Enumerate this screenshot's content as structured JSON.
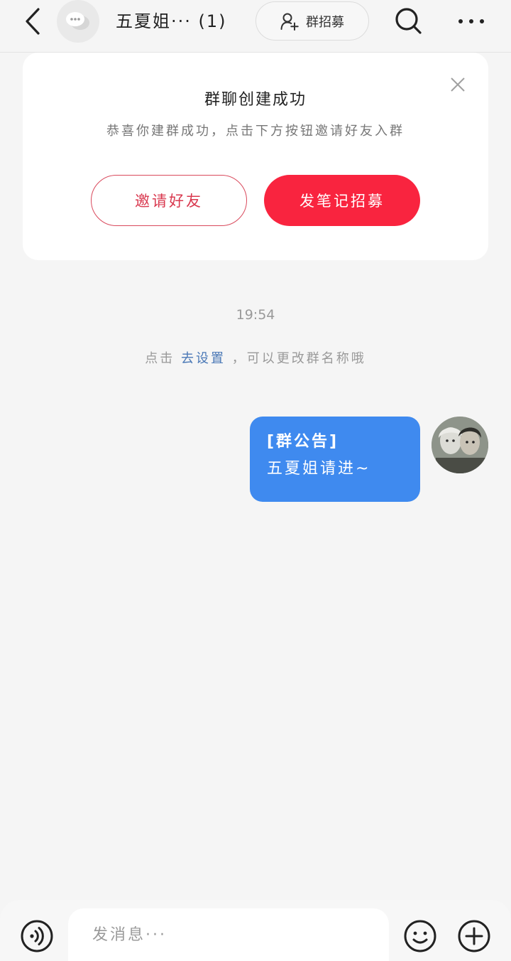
{
  "header": {
    "title": "五夏姐··· (1)",
    "recruit_label": "群招募"
  },
  "card": {
    "title": "群聊创建成功",
    "subtitle": "恭喜你建群成功，点击下方按钮邀请好友入群",
    "invite_label": "邀请好友",
    "post_note_label": "发笔记招募"
  },
  "chat": {
    "timestamp": "19:54",
    "system_prefix": "点击",
    "system_link": "去设置",
    "system_suffix": "，可以更改群名称哦",
    "message": {
      "line1": "[群公告]",
      "line2": "五夏姐请进~"
    }
  },
  "input": {
    "placeholder": "发消息···"
  },
  "icons": {
    "back": "chevron-left-icon",
    "group": "chat-bubble-icon",
    "recruit": "add-user-icon",
    "search": "search-icon",
    "more": "more-dots-icon",
    "close": "close-icon",
    "voice": "voice-icon",
    "emoji": "emoji-icon",
    "plus": "plus-icon"
  },
  "colors": {
    "primary_red": "#f9243f",
    "bubble_blue": "#3f8aef",
    "link_blue": "#4a78b6"
  }
}
